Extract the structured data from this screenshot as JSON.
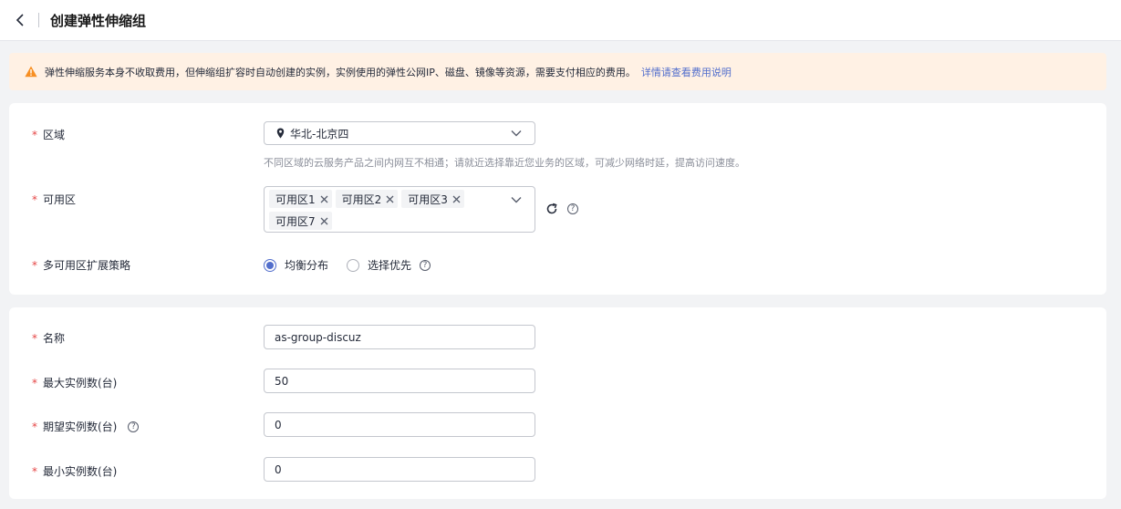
{
  "header": {
    "title": "创建弹性伸缩组"
  },
  "notice": {
    "text": "弹性伸缩服务本身不收取费用，但伸缩组扩容时自动创建的实例，实例使用的弹性公网IP、磁盘、镜像等资源，需要支付相应的费用。",
    "link": "详情请查看费用说明"
  },
  "region": {
    "label": "区域",
    "value": "华北-北京四",
    "hint": "不同区域的云服务产品之间内网互不相通；请就近选择靠近您业务的区域，可减少网络时延，提高访问速度。"
  },
  "az": {
    "label": "可用区",
    "tags": [
      "可用区1",
      "可用区2",
      "可用区3",
      "可用区7"
    ]
  },
  "strategy": {
    "label": "多可用区扩展策略",
    "options": [
      "均衡分布",
      "选择优先"
    ],
    "selected": "均衡分布"
  },
  "fields": {
    "name": {
      "label": "名称",
      "value": "as-group-discuz"
    },
    "max": {
      "label": "最大实例数(台)",
      "value": "50"
    },
    "desired": {
      "label": "期望实例数(台)",
      "value": "0"
    },
    "min": {
      "label": "最小实例数(台)",
      "value": "0"
    }
  },
  "colors": {
    "accent": "#526ecc",
    "required": "#e54545",
    "warning": "#f78f22",
    "notice_bg": "#fff1e4"
  }
}
